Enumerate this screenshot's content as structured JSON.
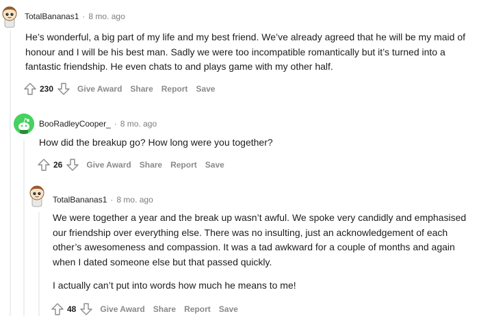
{
  "comments": [
    {
      "username": "TotalBananas1",
      "separator": "·",
      "time": "8 mo. ago",
      "paragraphs": [
        "He’s wonderful, a big part of my life and my best friend. We’ve already agreed that he will be my maid of honour and I will be his best man. Sadly we were too incompatible romantically but it’s turned into a fantastic friendship. He even chats to and plays game with my other half."
      ],
      "score": "230",
      "actions": {
        "award": "Give Award",
        "share": "Share",
        "report": "Report",
        "save": "Save"
      }
    },
    {
      "username": "BooRadleyCooper_",
      "separator": "·",
      "time": "8 mo. ago",
      "paragraphs": [
        "How did the breakup go? How long were you together?"
      ],
      "score": "26",
      "actions": {
        "award": "Give Award",
        "share": "Share",
        "report": "Report",
        "save": "Save"
      }
    },
    {
      "username": "TotalBananas1",
      "separator": "·",
      "time": "8 mo. ago",
      "paragraphs": [
        "We were together a year and the break up wasn’t awful. We spoke very candidly and emphasised our friendship over everything else. There was no insulting, just an acknowledgement of each other’s awesomeness and compassion. It was a tad awkward for a couple of months and again when I dated someone else but that passed quickly.",
        "I actually can’t put into words how much he means to me!"
      ],
      "score": "48",
      "actions": {
        "award": "Give Award",
        "share": "Share",
        "report": "Report",
        "save": "Save"
      }
    }
  ],
  "colors": {
    "meta": "#7c7c7c",
    "action": "#878a8c",
    "thread": "#edeff1",
    "green_avatar": "#46d160"
  },
  "icons": [
    "upvote-icon",
    "downvote-icon",
    "avatar-icon"
  ]
}
